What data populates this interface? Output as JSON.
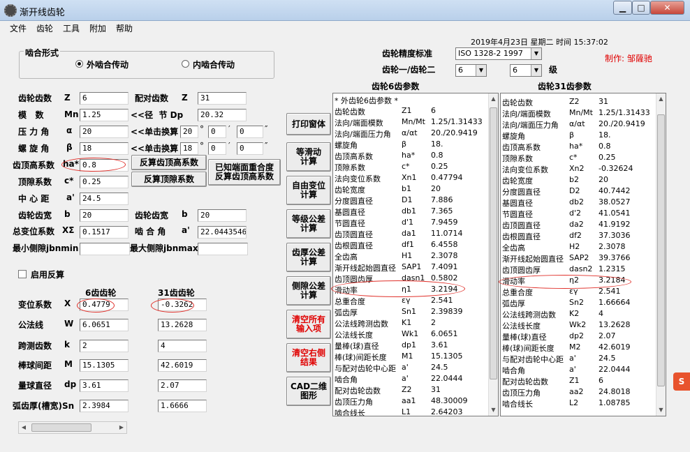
{
  "window": {
    "title": "渐开线齿轮",
    "minimize": "▁",
    "maximize": "□",
    "close": "✕"
  },
  "menu": [
    "文件",
    "齿轮",
    "工具",
    "附加",
    "帮助"
  ],
  "datetime": "2019年4月23日  星期二  时间  15:37:02",
  "author": "制作: 邹薩驰",
  "mesh": {
    "title": "啮合形式",
    "external": "外啮合传动",
    "internal": "内啮合传动",
    "selected": "external"
  },
  "accuracy": {
    "label": "齿轮精度标准",
    "value": "ISO 1328-2 1997",
    "pair_label": "齿轮一/齿轮二",
    "g1": "6",
    "g2": "6",
    "level": "级"
  },
  "params": {
    "z_label": "齿轮齿数",
    "z_sym": "Z",
    "z_val": "6",
    "z2_label": "配对齿数",
    "z2_sym": "Z",
    "z2_val": "31",
    "m_label": "模   数",
    "m_sym": "Mn",
    "m_val": "1.25",
    "dp_label": "<<径  节 Dp",
    "dp_val": "20.32",
    "alpha_label": "压 力 角",
    "alpha_sym": "α",
    "alpha_val": "20",
    "conv1_label": "<<单击换算",
    "conv1_deg": "20",
    "conv1_min": "0",
    "conv1_sec": "0",
    "beta_label": "螺 旋 角",
    "beta_sym": "β",
    "beta_val": "18",
    "conv2_label": "<<单击换算",
    "conv2_deg": "18",
    "conv2_min": "0",
    "conv2_sec": "0",
    "deg": "°",
    "min": "′",
    "sec": "″",
    "ha_label": "齿顶高系数",
    "ha_sym": "ha*",
    "ha_val": "0.8",
    "c_label": "顶隙系数",
    "c_sym": "c*",
    "c_val": "0.25",
    "a_label": "中 心 距",
    "a_sym": "a'",
    "a_val": "24.5",
    "b_label": "齿轮齿宽",
    "b_sym": "b",
    "b_val": "20",
    "b2_label": "齿轮齿宽",
    "b2_sym": "b",
    "b2_val": "20",
    "xs_label": "总变位系数",
    "xs_sym": "XΣ",
    "xs_val": "0.1517",
    "aw_label": "啮 合 角",
    "aw_sym": "a'",
    "aw_val": "22.04435462",
    "jmin_label": "最小侧隙jbnmin",
    "jmin_val": "",
    "jmax_label": "最大侧隙jbnmax",
    "jmax_val": ""
  },
  "buttons": {
    "rev_ha": "反算齿顶高系数",
    "rev_c": "反算顶隙系数",
    "rev_overlap": "已知端面重合度\n反算齿顶高系数",
    "print": "打印窗体",
    "equal_slide": "等滑动\n计算",
    "free_shift": "自由变位\n计算",
    "grade_tol": "等级公差\n计算",
    "thick_tol": "齿厚公差\n计算",
    "backlash_tol": "侧隙公差\n计算",
    "clear_inputs": "清空所有\n输入项",
    "clear_results": "清空右侧\n结果",
    "cad": "CAD二维\n图形"
  },
  "enable_reverse": "启用反算",
  "gear_cols": {
    "g1": "6齿齿轮",
    "g2": "31齿齿轮"
  },
  "gear_rows": [
    {
      "label": "变位系数",
      "sym": "X",
      "v1": "0.4779",
      "v2": "-0.3262"
    },
    {
      "label": "公法线",
      "sym": "W",
      "v1": "6.0651",
      "v2": "13.2628"
    },
    {
      "label": "跨测齿数",
      "sym": "k",
      "v1": "2",
      "v2": "4"
    },
    {
      "label": "棒球间距",
      "sym": "M",
      "v1": "15.1305",
      "v2": "42.6019"
    },
    {
      "label": "量球直径",
      "sym": "dp",
      "v1": "3.61",
      "v2": "2.07"
    },
    {
      "label": "弧齿厚(槽宽)Sn",
      "sym": "",
      "v1": "2.3984",
      "v2": "1.6666"
    }
  ],
  "list1": {
    "title": "齿轮6齿参数",
    "rows": [
      [
        "  * 外齿轮6齿参数 *",
        "",
        ""
      ],
      [
        "齿轮齿数",
        "Z1",
        "6"
      ],
      [
        "法向/端面模数",
        "Mn/Mt",
        "1.25/1.31433"
      ],
      [
        "法向/端面压力角",
        "α/αt",
        "20./20.9419"
      ],
      [
        "螺旋角",
        "β",
        "18."
      ],
      [
        "齿顶高系数",
        "ha*",
        "0.8"
      ],
      [
        "顶隙系数",
        "c*",
        "0.25"
      ],
      [
        "法向变位系数",
        "Xn1",
        "0.47794"
      ],
      [
        "齿轮宽度",
        "b1",
        "20"
      ],
      [
        "分度圆直径",
        "D1",
        "7.886"
      ],
      [
        "基圆直径",
        "db1",
        "7.365"
      ],
      [
        "节圆直径",
        "d'1",
        "7.9459"
      ],
      [
        "齿顶圆直径",
        "da1",
        "11.0714"
      ],
      [
        "齿根圆直径",
        "df1",
        "6.4558"
      ],
      [
        "全齿高",
        "H1",
        "2.3078"
      ],
      [
        "渐开线起始圆直径",
        "SAP1",
        "7.4091"
      ],
      [
        "齿顶圆齿厚",
        "dasn1",
        "0.5802"
      ],
      [
        "滑动率",
        "η1",
        "3.2194"
      ],
      [
        "总重合度",
        "εγ",
        "2.541"
      ],
      [
        "弧齿厚",
        "Sn1",
        "2.39839"
      ],
      [
        "公法线跨测齿数",
        "K1",
        "2"
      ],
      [
        "公法线长度",
        "Wk1",
        "6.0651"
      ],
      [
        "量棒(球)直径",
        "dp1",
        "3.61"
      ],
      [
        "棒(球)间距长度",
        "M1",
        "15.1305"
      ],
      [
        "与配对齿轮中心距",
        "a'",
        "24.5"
      ],
      [
        "啮合角",
        "a'",
        "22.0444"
      ],
      [
        "配对齿轮齿数",
        "Z2",
        "31"
      ],
      [
        "齿顶压力角",
        "aa1",
        "48.30009"
      ],
      [
        "啮合线长",
        "L1",
        "2.64203"
      ]
    ]
  },
  "list2": {
    "title": "齿轮31齿参数",
    "rows": [
      [
        "齿轮齿数",
        "Z2",
        "31"
      ],
      [
        "法向/端面模数",
        "Mn/Mt",
        "1.25/1.31433"
      ],
      [
        "法向/端面压力角",
        "α/αt",
        "20./20.9419"
      ],
      [
        "螺旋角",
        "β",
        "18."
      ],
      [
        "齿顶高系数",
        "ha*",
        "0.8"
      ],
      [
        "顶隙系数",
        "c*",
        "0.25"
      ],
      [
        "法向变位系数",
        "Xn2",
        "-0.32624"
      ],
      [
        "齿轮宽度",
        "b2",
        "20"
      ],
      [
        "分度圆直径",
        "D2",
        "40.7442"
      ],
      [
        "基圆直径",
        "db2",
        "38.0527"
      ],
      [
        "节圆直径",
        "d'2",
        "41.0541"
      ],
      [
        "齿顶圆直径",
        "da2",
        "41.9192"
      ],
      [
        "齿根圆直径",
        "df2",
        "37.3036"
      ],
      [
        "全齿高",
        "H2",
        "2.3078"
      ],
      [
        "渐开线起始圆直径",
        "SAP2",
        "39.3766"
      ],
      [
        "齿顶圆齿厚",
        "dasn2",
        "1.2315"
      ],
      [
        "滑动率",
        "η2",
        "3.2184"
      ],
      [
        "总重合度",
        "εγ",
        "2.541"
      ],
      [
        "弧齿厚",
        "Sn2",
        "1.66664"
      ],
      [
        "公法线跨测齿数",
        "K2",
        "4"
      ],
      [
        "公法线长度",
        "Wk2",
        "13.2628"
      ],
      [
        "量棒(球)直径",
        "dp2",
        "2.07"
      ],
      [
        "棒(球)间距长度",
        "M2",
        "42.6019"
      ],
      [
        "与配对齿轮中心距",
        "a'",
        "24.5"
      ],
      [
        "啮合角",
        "a'",
        "22.0444"
      ],
      [
        "配对齿轮齿数",
        "Z1",
        "6"
      ],
      [
        "齿顶压力角",
        "aa2",
        "24.8018"
      ],
      [
        "啮合线长",
        "L2",
        "1.08785"
      ]
    ]
  },
  "colors": {
    "accent_red": "#e00000",
    "highlight_ellipse": "#e0302a"
  }
}
